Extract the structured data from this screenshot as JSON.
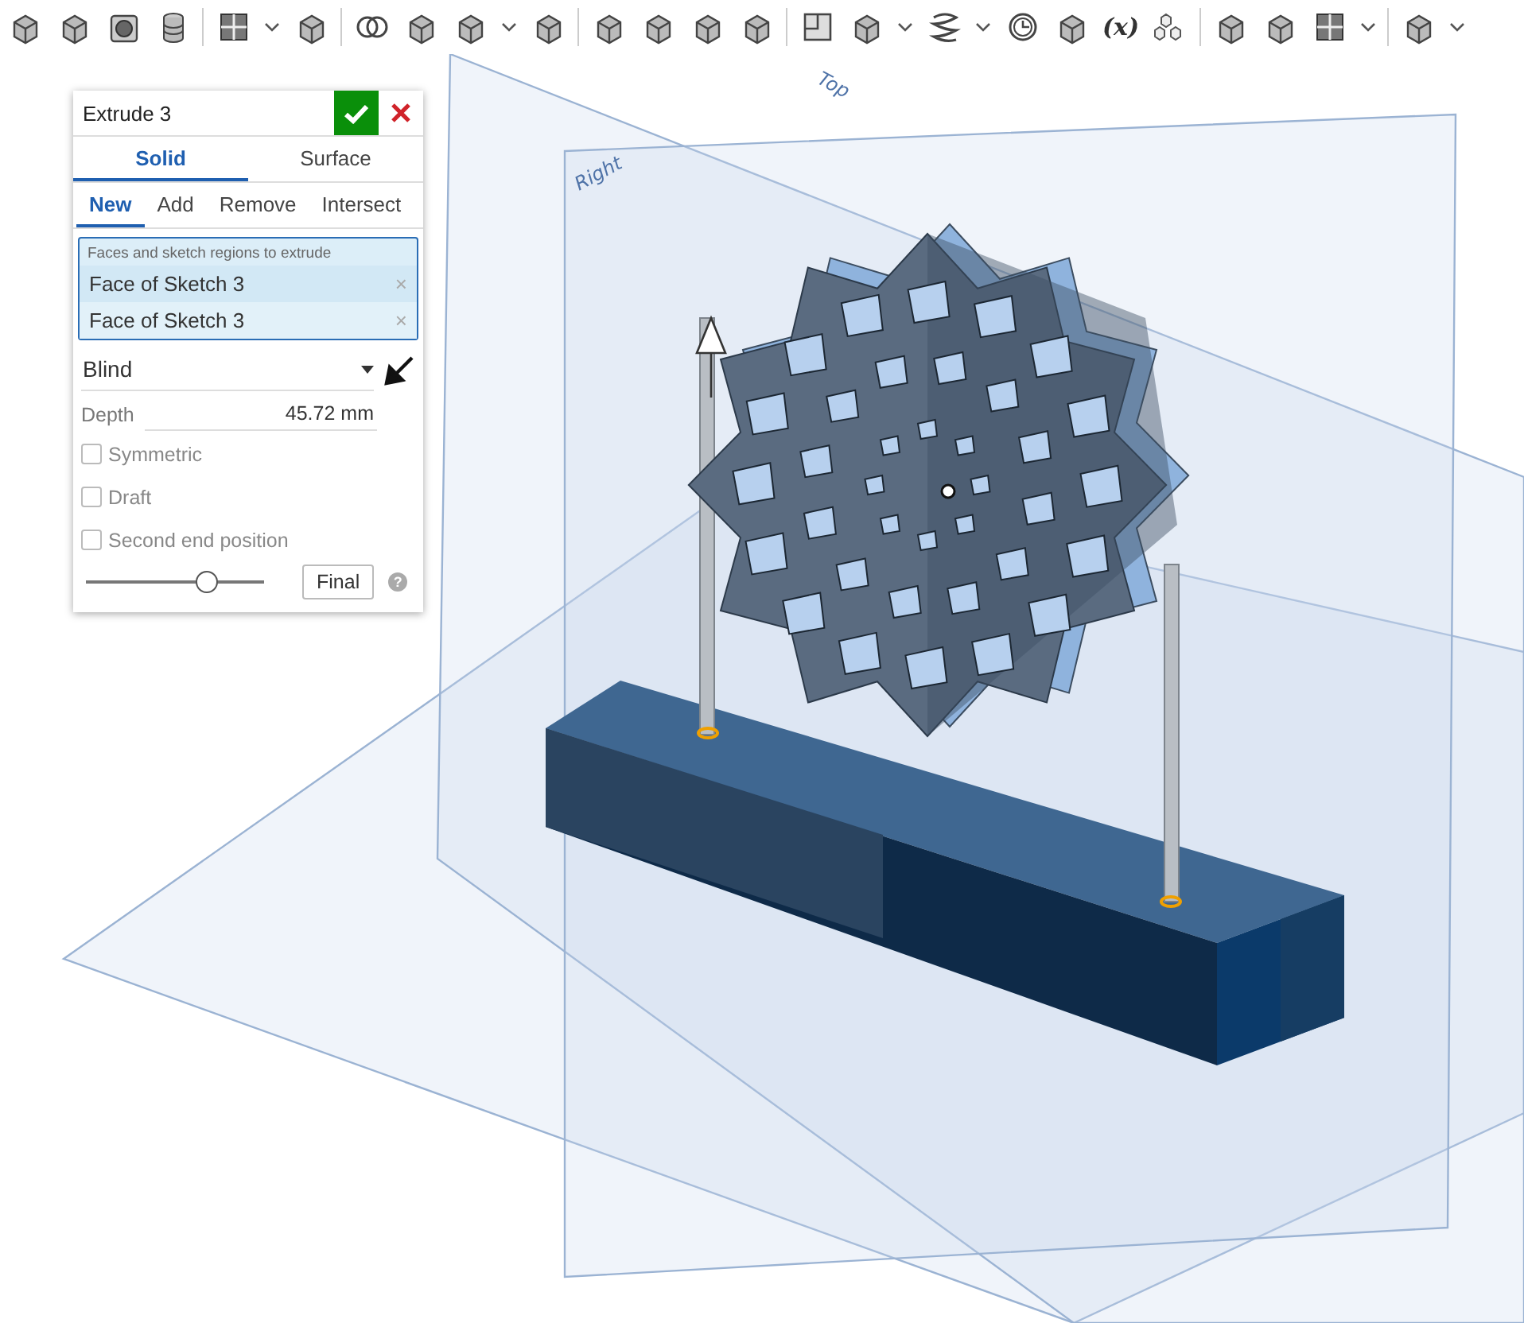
{
  "toolbar": [
    [
      {
        "kind": "cube"
      },
      {
        "kind": "cube"
      },
      {
        "kind": "sphere"
      },
      {
        "kind": "cylinder"
      }
    ],
    [
      {
        "kind": "grid"
      },
      {
        "kind": "caret"
      },
      {
        "kind": "cube"
      }
    ],
    [
      {
        "kind": "circles"
      },
      {
        "kind": "cube"
      },
      {
        "kind": "cube"
      },
      {
        "kind": "caret"
      },
      {
        "kind": "cube"
      }
    ],
    [
      {
        "kind": "cube"
      },
      {
        "kind": "cube"
      },
      {
        "kind": "cube"
      },
      {
        "kind": "cube"
      }
    ],
    [
      {
        "kind": "plane"
      },
      {
        "kind": "cube"
      },
      {
        "kind": "caret"
      },
      {
        "kind": "spring"
      },
      {
        "kind": "caret"
      },
      {
        "kind": "clock"
      },
      {
        "kind": "cube"
      },
      {
        "kind": "text",
        "label": "(x)"
      },
      {
        "kind": "cubes"
      }
    ],
    [
      {
        "kind": "cube"
      },
      {
        "kind": "cube"
      },
      {
        "kind": "grid"
      },
      {
        "kind": "caret"
      }
    ],
    [
      {
        "kind": "cube"
      },
      {
        "kind": "caret"
      }
    ]
  ],
  "viewport": {
    "plane_labels": [
      "Top",
      "Right"
    ]
  },
  "panel": {
    "title": "Extrude 3",
    "tabs": [
      {
        "label": "Solid",
        "selected": true
      },
      {
        "label": "Surface",
        "selected": false
      }
    ],
    "operations": [
      {
        "label": "New",
        "selected": true
      },
      {
        "label": "Add",
        "selected": false
      },
      {
        "label": "Remove",
        "selected": false
      },
      {
        "label": "Intersect",
        "selected": false
      }
    ],
    "selection": {
      "caption": "Faces and sketch regions to extrude",
      "items": [
        {
          "label": "Face of Sketch 3",
          "remove": "×"
        },
        {
          "label": "Face of Sketch 3",
          "remove": "×"
        }
      ]
    },
    "end_type": "Blind",
    "depth": {
      "label": "Depth",
      "value": "45.72 mm"
    },
    "options": [
      {
        "label": "Symmetric",
        "checked": false
      },
      {
        "label": "Draft",
        "checked": false
      },
      {
        "label": "Second end position",
        "checked": false
      }
    ],
    "slider": {
      "level": 0.68
    },
    "final_button": "Final",
    "help": "?"
  }
}
